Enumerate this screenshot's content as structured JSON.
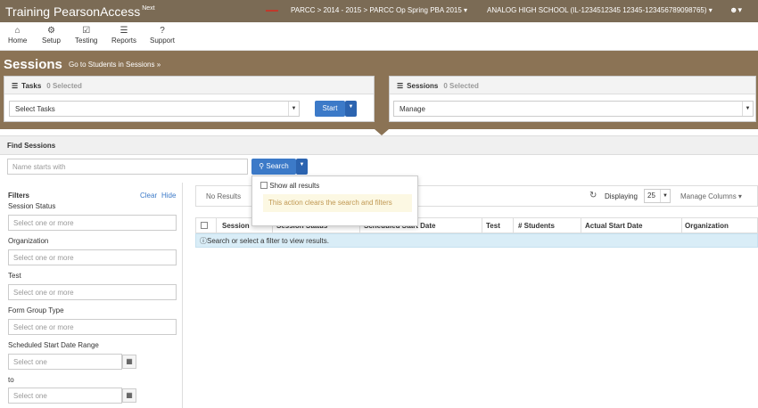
{
  "app": {
    "brand": "Training PearsonAccess",
    "brand_sup": "Next",
    "context_path": "PARCC > 2014 - 2015 > PARCC Op Spring PBA 2015 ▾",
    "school": "ANALOG HIGH SCHOOL (IL-1234512345 12345-123456789098765) ▾",
    "user_icon": "user-icon"
  },
  "nav": [
    {
      "label": "Home",
      "icon": "home-icon",
      "glyph": "⌂"
    },
    {
      "label": "Setup",
      "icon": "gear-icon",
      "glyph": "⚙"
    },
    {
      "label": "Testing",
      "icon": "checkbox-icon",
      "glyph": "☑"
    },
    {
      "label": "Reports",
      "icon": "list-icon",
      "glyph": "☰"
    },
    {
      "label": "Support",
      "icon": "help-icon",
      "glyph": "?"
    }
  ],
  "page": {
    "title": "Sessions",
    "link": "Go to Students in Sessions »"
  },
  "tasks": {
    "title": "Tasks",
    "count": "0 Selected",
    "select_value": "Select Tasks",
    "start_label": "Start"
  },
  "sessions_panel": {
    "title": "Sessions",
    "count": "0 Selected",
    "select_value": "Manage"
  },
  "find": {
    "title": "Find Sessions",
    "placeholder": "Name starts with",
    "search_label": "Search",
    "popover": {
      "show_all": "Show all results",
      "warning": "This action clears the search and filters"
    }
  },
  "filters": {
    "title": "Filters",
    "clear": "Clear",
    "hide": "Hide",
    "session_status": "Session Status",
    "organization": "Organization",
    "test": "Test",
    "form_group_type": "Form Group Type",
    "date_range": "Scheduled Start Date Range",
    "to": "to",
    "select_placeholder": "Select one or more",
    "date_placeholder": "Select one"
  },
  "results": {
    "no_results": "No Results",
    "displaying": "Displaying",
    "page_size": "25",
    "manage_columns": "Manage Columns ▾",
    "columns": [
      "Session",
      "Session Status",
      "Scheduled Start Date",
      "Test",
      "# Students",
      "Actual Start Date",
      "Organization"
    ],
    "info": "Search or select a filter to view results."
  }
}
